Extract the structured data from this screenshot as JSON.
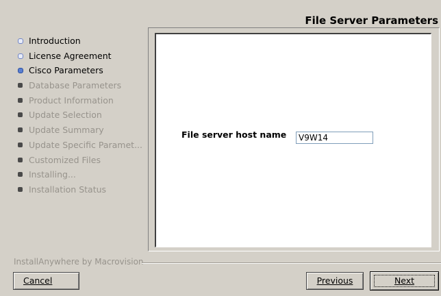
{
  "header": {
    "title": "File Server Parameters"
  },
  "steps": [
    {
      "label": "Introduction",
      "state": "done"
    },
    {
      "label": "License Agreement",
      "state": "done"
    },
    {
      "label": "Cisco Parameters",
      "state": "current"
    },
    {
      "label": "Database Parameters",
      "state": "pending"
    },
    {
      "label": "Product Information",
      "state": "pending"
    },
    {
      "label": "Update Selection",
      "state": "pending"
    },
    {
      "label": "Update Summary",
      "state": "pending"
    },
    {
      "label": "Update Specific Paramet...",
      "state": "pending"
    },
    {
      "label": "Customized Files",
      "state": "pending"
    },
    {
      "label": "Installing...",
      "state": "pending"
    },
    {
      "label": "Installation Status",
      "state": "pending"
    }
  ],
  "form": {
    "host_label": "File server host name",
    "host_value": "V9W14"
  },
  "footer": {
    "vendor": "InstallAnywhere by Macrovision",
    "cancel_label": "Cancel",
    "previous_label": "Previous",
    "next_label": "Next"
  },
  "colors": {
    "background": "#d4d0c8",
    "panel": "#ffffff",
    "disabled_text": "#97938c",
    "current_bullet": "#5a7fd0"
  }
}
